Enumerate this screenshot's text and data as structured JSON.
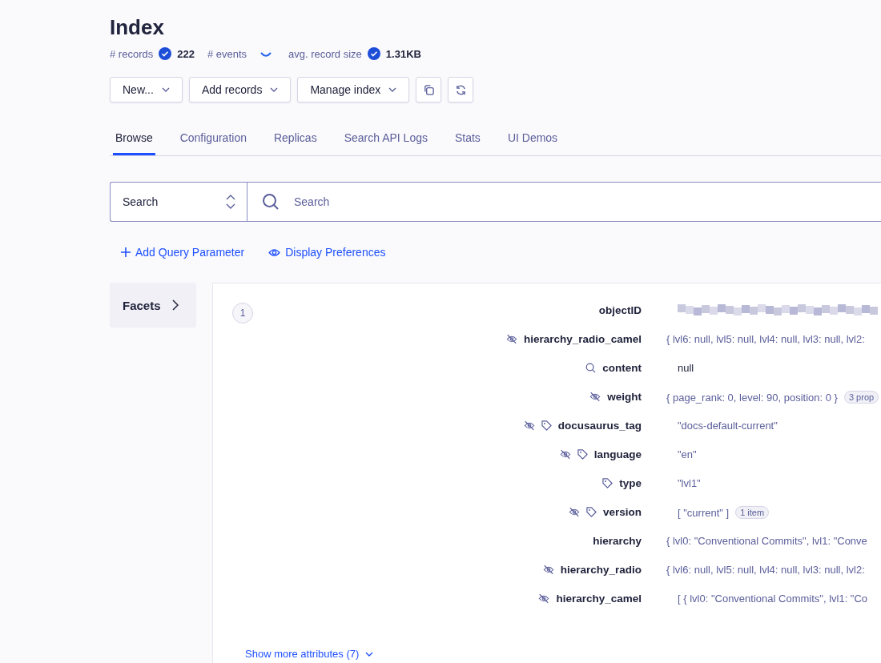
{
  "page": {
    "title": "Index"
  },
  "stats": [
    {
      "label": "# records",
      "loading": false,
      "value": "222"
    },
    {
      "label": "# events",
      "loading": true
    },
    {
      "label": "avg. record size",
      "loading": false,
      "value": "1.31KB"
    }
  ],
  "toolbar": [
    {
      "kind": "menu",
      "label": "New..."
    },
    {
      "kind": "menu",
      "label": "Add records"
    },
    {
      "kind": "menu",
      "label": "Manage index"
    },
    {
      "kind": "copy"
    },
    {
      "kind": "refresh"
    }
  ],
  "tabs": [
    {
      "label": "Browse",
      "selected": true
    },
    {
      "label": "Configuration",
      "selected": false
    },
    {
      "label": "Replicas",
      "selected": false
    },
    {
      "label": "Search API Logs",
      "selected": false
    },
    {
      "label": "Stats",
      "selected": false
    },
    {
      "label": "UI Demos",
      "selected": false
    }
  ],
  "search": {
    "mode": "Search",
    "placeholder": "Search"
  },
  "links": [
    {
      "kind": "add",
      "label": "Add Query Parameter"
    },
    {
      "kind": "view",
      "label": "Display Preferences"
    }
  ],
  "facets": {
    "label": "Facets"
  },
  "record": {
    "number": "1",
    "attributes": [
      {
        "key": "objectID",
        "hidden": false,
        "facet": false,
        "searchable": false,
        "kind": "redacted"
      },
      {
        "key": "hierarchy_radio_camel",
        "hidden": true,
        "facet": false,
        "searchable": false,
        "kind": "object",
        "value": "{ lvl6: null, lvl5: null, lvl4: null, lvl3: null, lvl2:"
      },
      {
        "key": "content",
        "hidden": false,
        "facet": false,
        "searchable": true,
        "kind": "null",
        "value": "null"
      },
      {
        "key": "weight",
        "hidden": true,
        "facet": false,
        "searchable": false,
        "kind": "object",
        "value": "{ page_rank: 0, level: 90, position: 0 }",
        "badge": "3 prop"
      },
      {
        "key": "docusaurus_tag",
        "hidden": true,
        "facet": true,
        "searchable": false,
        "kind": "string",
        "value": "\"docs-default-current\""
      },
      {
        "key": "language",
        "hidden": true,
        "facet": true,
        "searchable": false,
        "kind": "string",
        "value": "\"en\""
      },
      {
        "key": "type",
        "hidden": false,
        "facet": true,
        "searchable": false,
        "kind": "string",
        "value": "\"lvl1\""
      },
      {
        "key": "version",
        "hidden": true,
        "facet": true,
        "searchable": false,
        "kind": "array",
        "value": "[ \"current\" ]",
        "badge": "1 item"
      },
      {
        "key": "hierarchy",
        "hidden": false,
        "facet": false,
        "searchable": false,
        "kind": "object",
        "value": "{ lvl0: \"Conventional Commits\", lvl1: \"Conve"
      },
      {
        "key": "hierarchy_radio",
        "hidden": true,
        "facet": false,
        "searchable": false,
        "kind": "object",
        "value": "{ lvl6: null, lvl5: null, lvl4: null, lvl3: null, lvl2:"
      },
      {
        "key": "hierarchy_camel",
        "hidden": true,
        "facet": false,
        "searchable": false,
        "kind": "array",
        "value": "[ { lvl0: \"Conventional Commits\", lvl1: \"Co"
      }
    ],
    "more": "Show more attributes (7)"
  }
}
